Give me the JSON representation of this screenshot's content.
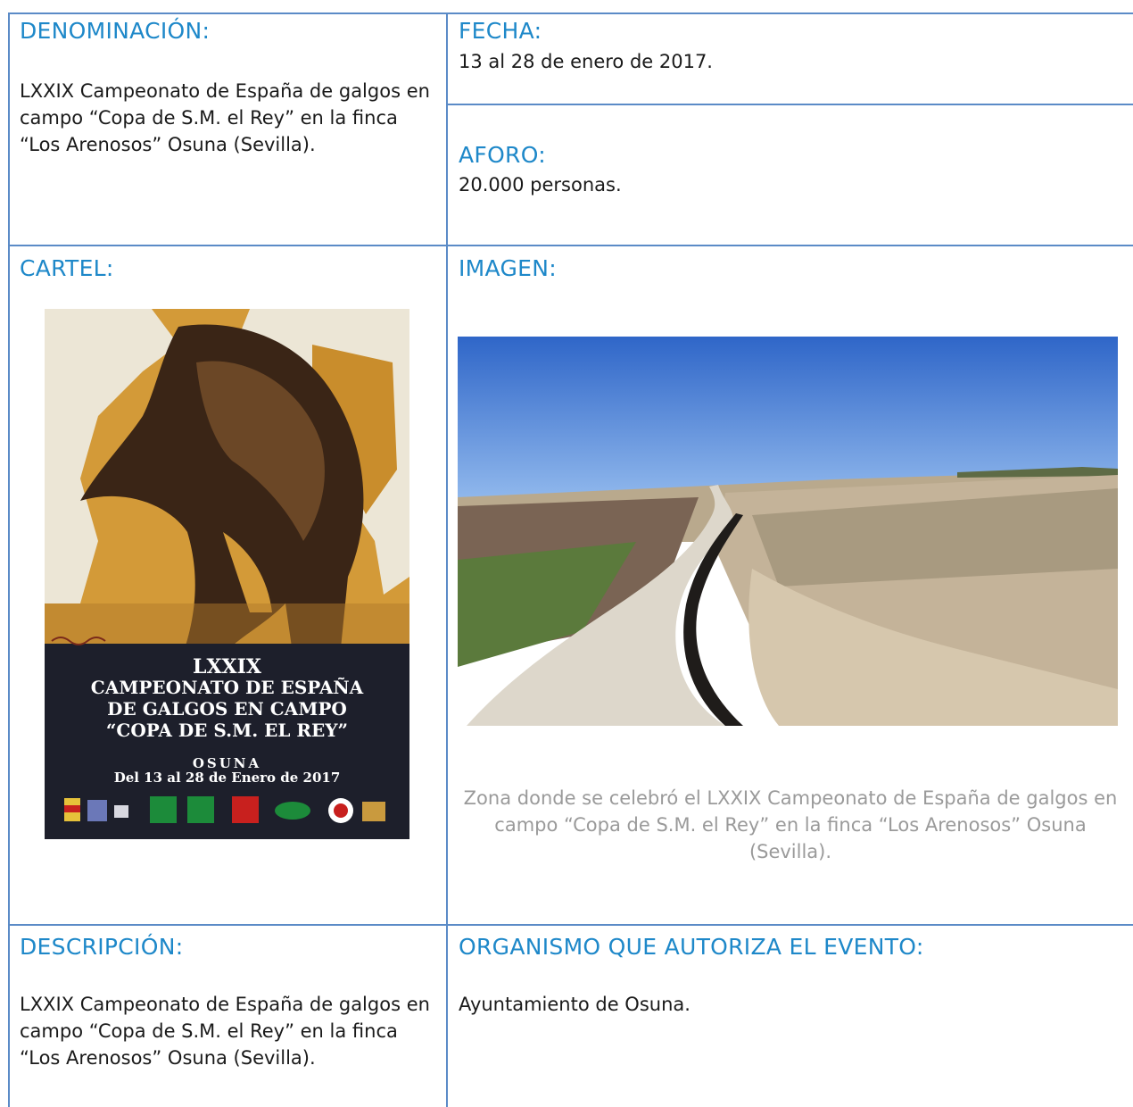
{
  "denominacion": {
    "label": "DENOMINACIÓN:",
    "text": "LXXIX Campeonato de España de galgos en campo “Copa de S.M. el Rey” en la finca “Los Arenosos” Osuna (Sevilla)."
  },
  "fecha": {
    "label": "FECHA:",
    "text": "13 al 28 de enero de 2017."
  },
  "aforo": {
    "label": "AFORO:",
    "text": "20.000 personas."
  },
  "cartel": {
    "label": "CARTEL:",
    "poster": {
      "line1": "LXXIX",
      "line2": "CAMPEONATO DE ESPAÑA",
      "line3": "DE GALGOS EN CAMPO",
      "line4": "“COPA DE S.M. EL REY”",
      "line5": "OSUNA",
      "line6": "Del 13 al 28 de Enero de 2017"
    }
  },
  "imagen": {
    "label": "IMAGEN:",
    "caption": "Zona donde se celebró el LXXIX Campeonato de España de galgos en campo “Copa de S.M. el Rey” en la finca “Los Arenosos” Osuna (Sevilla)."
  },
  "descripcion": {
    "label": "DESCRIPCIÓN:",
    "text": "LXXIX Campeonato de España de galgos en campo “Copa de S.M. el Rey” en la finca “Los Arenosos” Osuna (Sevilla)."
  },
  "organismo": {
    "label": "ORGANISMO QUE AUTORIZA EL EVENTO:",
    "text": "Ayuntamiento de Osuna."
  },
  "colors": {
    "label": "#1e88c9",
    "border": "#5b8bc7",
    "caption": "#9a9a9a"
  }
}
